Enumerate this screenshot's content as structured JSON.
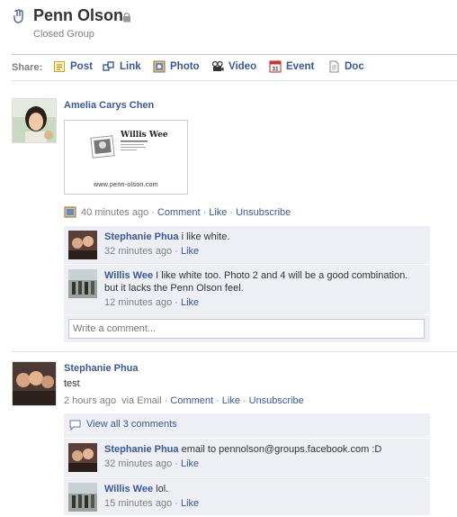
{
  "header": {
    "title": "Penn Olson",
    "subtitle": "Closed Group",
    "icons": {
      "group": "group-icon",
      "lock": "lock-icon"
    }
  },
  "share": {
    "label": "Share:",
    "items": [
      {
        "label": "Post",
        "icon": "post-icon"
      },
      {
        "label": "Link",
        "icon": "link-icon"
      },
      {
        "label": "Photo",
        "icon": "photo-icon"
      },
      {
        "label": "Video",
        "icon": "video-icon"
      },
      {
        "label": "Event",
        "icon": "event-icon"
      },
      {
        "label": "Doc",
        "icon": "doc-icon"
      }
    ]
  },
  "posts": [
    {
      "author": "Amelia Carys Chen",
      "attachment": {
        "card_name": "Willis Wee",
        "card_url": "www.penn-olson.com"
      },
      "meta": {
        "time": "40 minutes ago",
        "actions": [
          "Comment",
          "Like",
          "Unsubscribe"
        ]
      },
      "comments": [
        {
          "author": "Stephanie Phua",
          "text": "i like white.",
          "time": "32 minutes ago",
          "action": "Like"
        },
        {
          "author": "Willis Wee",
          "text": "I like white too. Photo 2 and 4 will be a good combination. but it lacks the Penn Olson feel.",
          "time": "12 minutes ago",
          "action": "Like"
        }
      ],
      "write_placeholder": "Write a comment..."
    },
    {
      "author": "Stephanie Phua",
      "text": "test",
      "meta": {
        "time": "2 hours ago",
        "via": "via Email",
        "actions": [
          "Comment",
          "Like",
          "Unsubscribe"
        ]
      },
      "view_all": "View all 3 comments",
      "comments": [
        {
          "author": "Stephanie Phua",
          "text": "email to pennolson@groups.facebook.com :D",
          "time": "32 minutes ago",
          "action": "Like"
        },
        {
          "author": "Willis Wee",
          "text": "lol.",
          "time": "15 minutes ago",
          "action": "Like"
        }
      ]
    }
  ],
  "colors": {
    "link": "#3b5998",
    "comment_bg": "#edeff4",
    "muted": "#808080"
  }
}
